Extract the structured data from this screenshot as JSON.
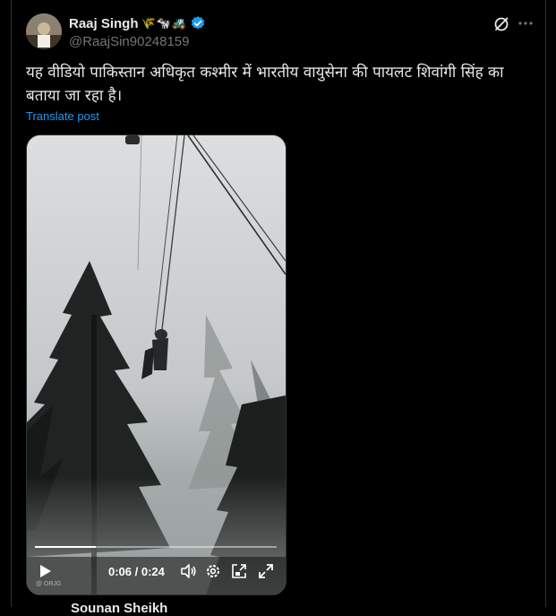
{
  "author": {
    "name": "Raaj Singh",
    "handle": "@RaajSin90248159",
    "badges": "🌾🐄🚜",
    "verified": true
  },
  "post": {
    "text": "यह वीडियो पाकिस्तान अधिकृत कश्मीर में भारतीय वायुसेना की पायलट शिवांगी सिंह का बताया जा रहा है।",
    "translate_label": "Translate post"
  },
  "video": {
    "current_time": "0:06",
    "duration": "0:24",
    "time_display": "0:06 / 0:24",
    "progress": 0.25,
    "watermark": "@ ORJG"
  },
  "next_post": {
    "name": "Sounan Sheikh"
  },
  "icons": {
    "grok": "grok-icon",
    "more": "more-icon",
    "play": "play-icon",
    "volume": "volume-icon",
    "settings": "settings-icon",
    "pip": "picture-in-picture-icon",
    "fullscreen": "fullscreen-icon"
  },
  "colors": {
    "accent": "#1d9bf0",
    "background": "#000000",
    "text": "#e7e9ea",
    "secondary": "#71767b"
  }
}
